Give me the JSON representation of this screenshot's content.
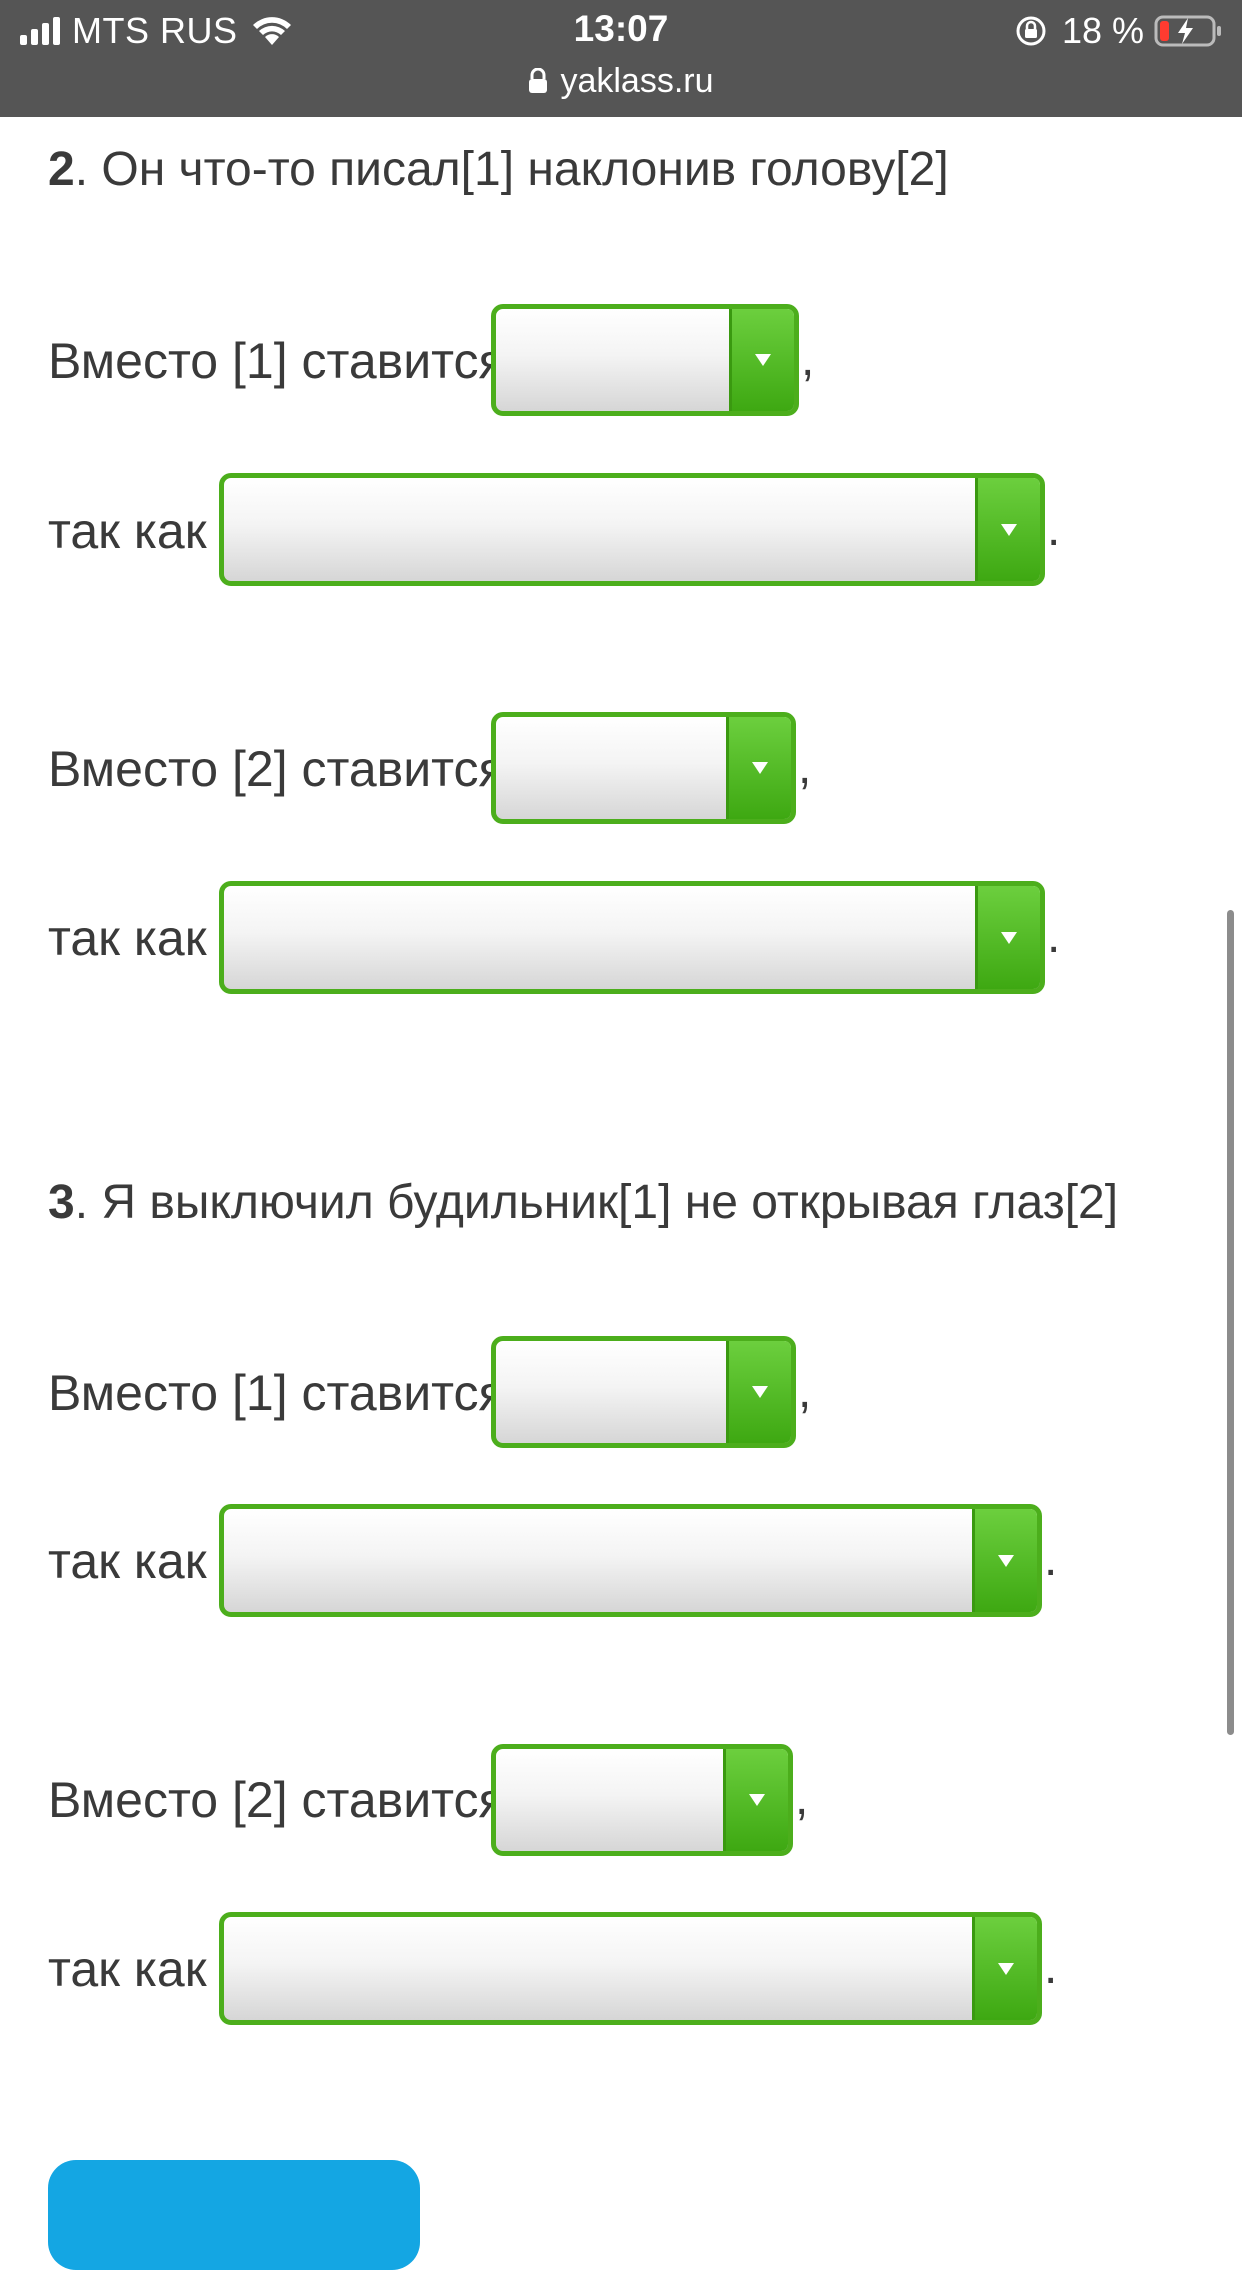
{
  "status_bar": {
    "carrier": "MTS RUS",
    "time": "13:07",
    "battery_percent": "18 %",
    "battery_level": 0.18,
    "url": "yaklass.ru",
    "icons": [
      "signal-icon",
      "wifi-icon",
      "rotation-lock-icon",
      "battery-charging-icon",
      "padlock-icon"
    ]
  },
  "questions": [
    {
      "number": "2",
      "sentence": ". Он что-то писал[1] наклонив голову[2]",
      "items": [
        {
          "place_label": "Вместо [1] ставится",
          "place_punct": ",",
          "reason_label": "так как",
          "reason_punct": "."
        },
        {
          "place_label": "Вместо [2] ставится",
          "place_punct": ",",
          "reason_label": "так как",
          "reason_punct": "."
        }
      ]
    },
    {
      "number": "3",
      "sentence": ". Я выключил будильник[1] не открывая глаз[2]",
      "items": [
        {
          "place_label": "Вместо [1] ставится",
          "place_punct": ",",
          "reason_label": "так как",
          "reason_punct": "."
        },
        {
          "place_label": "Вместо [2] ставится",
          "place_punct": ",",
          "reason_label": "так как",
          "reason_punct": "."
        }
      ]
    }
  ],
  "colors": {
    "status_bar_bg": "#555555",
    "dropdown_border": "#4cae1c",
    "dropdown_button": "#3ea812",
    "submit_button": "#14a6e3"
  }
}
